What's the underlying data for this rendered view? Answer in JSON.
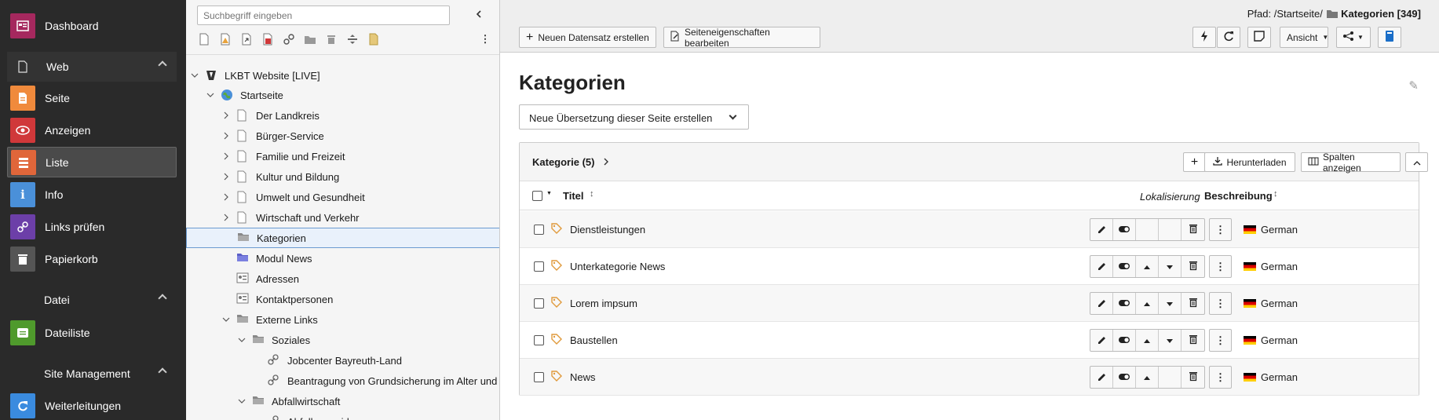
{
  "modules": {
    "dashboard": "Dashboard",
    "web_group": "Web",
    "seite": "Seite",
    "anzeigen": "Anzeigen",
    "liste": "Liste",
    "info": "Info",
    "links_pruefen": "Links prüfen",
    "papierkorb": "Papierkorb",
    "datei_group": "Datei",
    "dateiliste": "Dateiliste",
    "site_group": "Site Management",
    "weiterleitungen": "Weiterleitungen"
  },
  "tree": {
    "search_placeholder": "Suchbegriff eingeben",
    "nodes": [
      {
        "label": "LKBT Website [LIVE]",
        "icon": "typo3-icon"
      },
      {
        "label": "Startseite",
        "icon": "globe-icon"
      },
      {
        "label": "Der Landkreis",
        "icon": "page-icon"
      },
      {
        "label": "Bürger-Service",
        "icon": "page-icon"
      },
      {
        "label": "Familie und Freizeit",
        "icon": "page-icon"
      },
      {
        "label": "Kultur und Bildung",
        "icon": "page-icon"
      },
      {
        "label": "Umwelt und Gesundheit",
        "icon": "page-icon"
      },
      {
        "label": "Wirtschaft und Verkehr",
        "icon": "page-icon"
      },
      {
        "label": "Kategorien",
        "icon": "folder-icon"
      },
      {
        "label": "Modul News",
        "icon": "folder-news-icon"
      },
      {
        "label": "Adressen",
        "icon": "address-icon"
      },
      {
        "label": "Kontaktpersonen",
        "icon": "address-icon"
      },
      {
        "label": "Externe Links",
        "icon": "folder-icon"
      },
      {
        "label": "Soziales",
        "icon": "folder-icon"
      },
      {
        "label": "Jobcenter Bayreuth-Land",
        "icon": "link-icon"
      },
      {
        "label": "Beantragung von Grundsicherung im Alter und",
        "icon": "link-icon"
      },
      {
        "label": "Abfallwirtschaft",
        "icon": "folder-icon"
      },
      {
        "label": "Abfallvermeidung",
        "icon": "link-icon"
      }
    ]
  },
  "docheader": {
    "path_prefix": "Pfad: /Startseite/",
    "path_current": "Kategorien [349]",
    "new_record": "Neuen Datensatz erstellen",
    "edit_page_props": "Seiteneigenschaften bearbeiten",
    "view_label": "Ansicht"
  },
  "content": {
    "title": "Kategorien",
    "translation_select": "Neue Übersetzung dieser Seite erstellen",
    "table_title": "Kategorie (5)",
    "download": "Herunterladen",
    "show_columns": "Spalten anzeigen",
    "col_title": "Titel",
    "col_localization": "Lokalisierung",
    "col_description": "Beschreibung",
    "rows": [
      {
        "title": "Dienstleistungen",
        "lang": "German"
      },
      {
        "title": "Unterkategorie News",
        "lang": "German"
      },
      {
        "title": "Lorem impsum",
        "lang": "German"
      },
      {
        "title": "Baustellen",
        "lang": "German"
      },
      {
        "title": "News",
        "lang": "German"
      }
    ]
  },
  "colors": {
    "sidebar_bg": "#2a2a2a",
    "dashboard": "#a5285e",
    "seite": "#f08a3c",
    "anzeigen": "#d0383a",
    "liste": "#e0663a",
    "info": "#4a90d9",
    "links": "#6c3fa8",
    "papierkorb": "#555555",
    "dateiliste": "#4f9a2c",
    "weiterleitungen": "#3a8bdf"
  }
}
